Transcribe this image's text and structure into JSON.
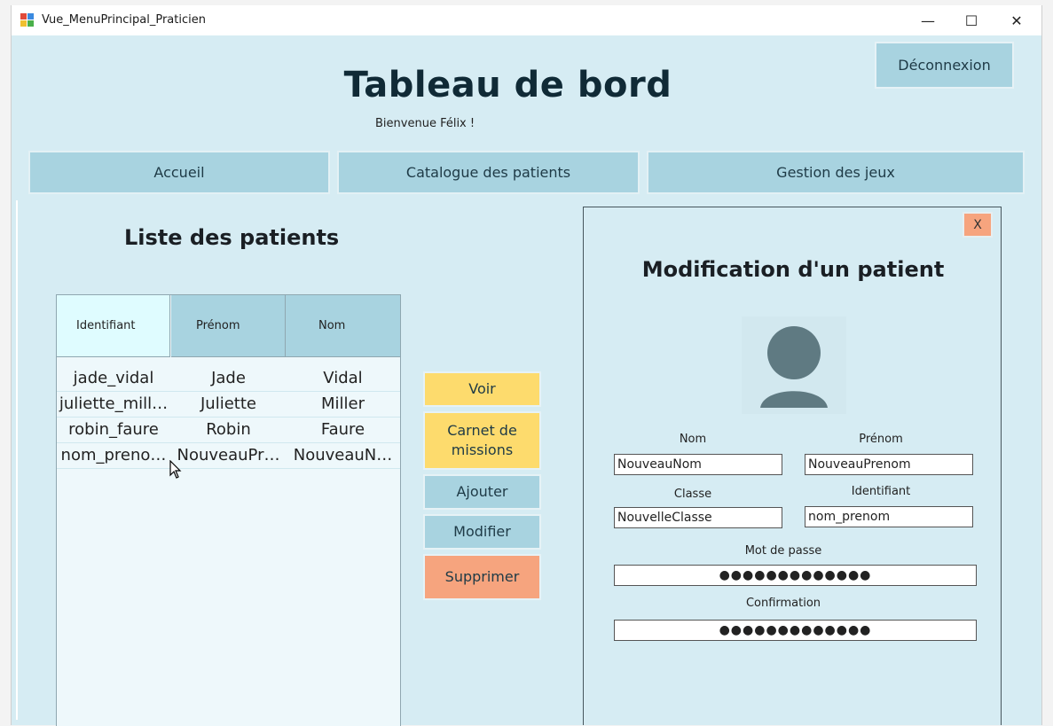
{
  "window": {
    "title": "Vue_MenuPrincipal_Praticien",
    "minimize": "—",
    "maximize": "☐",
    "close": "✕"
  },
  "header": {
    "title": "Tableau de bord",
    "welcome": "Bienvenue Félix !",
    "logout_label": "Déconnexion"
  },
  "nav": {
    "tabs": [
      {
        "label": "Accueil"
      },
      {
        "label": "Catalogue des patients"
      },
      {
        "label": "Gestion des jeux"
      }
    ]
  },
  "patients": {
    "title": "Liste des patients",
    "columns": [
      "Identifiant",
      "Prénom",
      "Nom"
    ],
    "rows": [
      [
        "jade_vidal",
        "Jade",
        "Vidal"
      ],
      [
        "juliette_mill…",
        "Juliette",
        "Miller"
      ],
      [
        "robin_faure",
        "Robin",
        "Faure"
      ],
      [
        "nom_preno…",
        "NouveauPr…",
        "NouveauN…"
      ]
    ]
  },
  "actions": {
    "voir": "Voir",
    "carnet": "Carnet de missions",
    "ajouter": "Ajouter",
    "modifier": "Modifier",
    "supprimer": "Supprimer"
  },
  "edit": {
    "close_label": "X",
    "title": "Modification d'un patient",
    "nom_label": "Nom",
    "nom_value": "NouveauNom",
    "prenom_label": "Prénom",
    "prenom_value": "NouveauPrenom",
    "classe_label": "Classe",
    "classe_value": "NouvelleClasse",
    "identifiant_label": "Identifiant",
    "identifiant_value": "nom_prenom",
    "password_label": "Mot de passe",
    "password_value": "●●●●●●●●●●●●●",
    "confirm_label": "Confirmation",
    "confirm_value": "●●●●●●●●●●●●●"
  },
  "colors": {
    "background": "#d6ecf3",
    "button_blue": "#a8d3e0",
    "button_yellow": "#fddb6d",
    "button_orange": "#f6a47e",
    "header_selected": "#dffcff"
  }
}
